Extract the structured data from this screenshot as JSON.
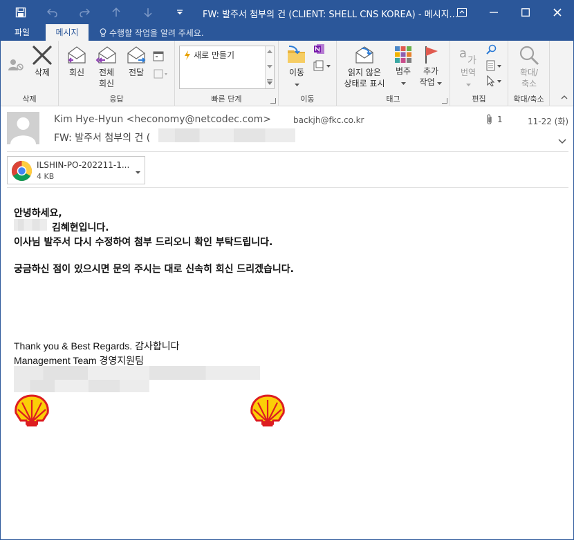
{
  "window": {
    "title": "FW: 발주서 첨부의 건 (CLIENT: SHELL CNS KOREA) - 메시지...",
    "colors": {
      "accent": "#2b579a",
      "ribbon_bg": "#f3f3f3"
    }
  },
  "quick_access": {
    "icons": [
      "save-icon",
      "undo-icon",
      "redo-icon",
      "up-icon",
      "down-icon",
      "customize-icon"
    ]
  },
  "tabs": [
    {
      "label": "파일"
    },
    {
      "label": "메시지"
    }
  ],
  "tellme": {
    "text": "수행할 작업을 알려 주세요."
  },
  "ribbon": {
    "groups": [
      {
        "label": "삭제"
      },
      {
        "label": "응답"
      },
      {
        "label": "빠른 단계"
      },
      {
        "label": "이동"
      },
      {
        "label": "태그"
      },
      {
        "label": "편집"
      },
      {
        "label": "확대/축소"
      }
    ],
    "buttons": {
      "delete": "삭제",
      "reply": "회신",
      "reply_all_1": "전체",
      "reply_all_2": "회신",
      "forward": "전달",
      "move": "이동",
      "unread_1": "읽지 않은",
      "unread_2": "상태로 표시",
      "category": "범주",
      "followup_1": "추가",
      "followup_2": "작업",
      "translate": "번역",
      "zoom_1": "확대/",
      "zoom_2": "축소"
    },
    "quick_steps": {
      "item": "새로 만들기"
    }
  },
  "message": {
    "from": "Kim Hye-Hyun <heconomy@netcodec.com>",
    "to": "backjh@fkc.co.kr",
    "attachment_count": "1",
    "date": "11-22 (화)",
    "subject": "FW: 발주서 첨부의 건 (",
    "attachment": {
      "name": "ILSHIN-PO-202211-1...",
      "size": "4 KB"
    }
  },
  "body": {
    "greeting": "안녕하세요,",
    "intro": "김혜현입니다.",
    "line1": "이사님 발주서 다시 수정하여 첨부 드리오니 확인 부탁드립니다.",
    "line2": "궁금하신 점이 있으시면 문의 주시는 대로 신속히 회신 드리겠습니다.",
    "sig1": "Thank you & Best Regards. 감사합니다",
    "sig2": "Management Team 경영지원팀"
  }
}
